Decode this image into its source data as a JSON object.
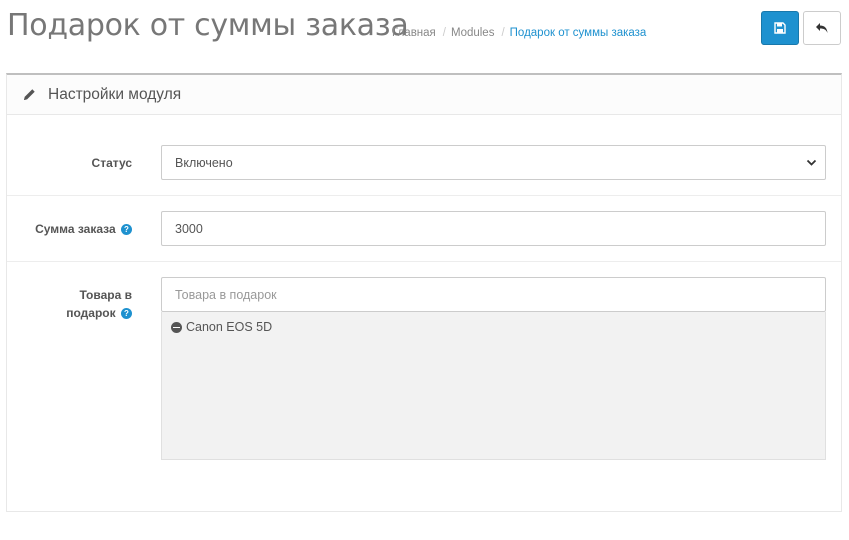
{
  "header": {
    "title": "Подарок от суммы заказа",
    "breadcrumb": [
      {
        "label": "Главная"
      },
      {
        "label": "Modules"
      },
      {
        "label": "Подарок от суммы заказа"
      }
    ]
  },
  "toolbar": {
    "save_icon": "floppy-disk-icon",
    "back_icon": "reply-icon"
  },
  "panel": {
    "icon": "pencil-icon",
    "title": "Настройки модуля"
  },
  "form": {
    "status": {
      "label": "Статус",
      "value": "Включено"
    },
    "order_sum": {
      "label": "Сумма заказа",
      "value": "3000",
      "help": "?"
    },
    "gifts": {
      "label_line1": "Товара в",
      "label_line2": "подарок",
      "help": "?",
      "placeholder": "Товара в подарок",
      "items": [
        {
          "name": "Canon EOS 5D"
        }
      ]
    }
  },
  "colors": {
    "accent": "#1e91cf"
  }
}
